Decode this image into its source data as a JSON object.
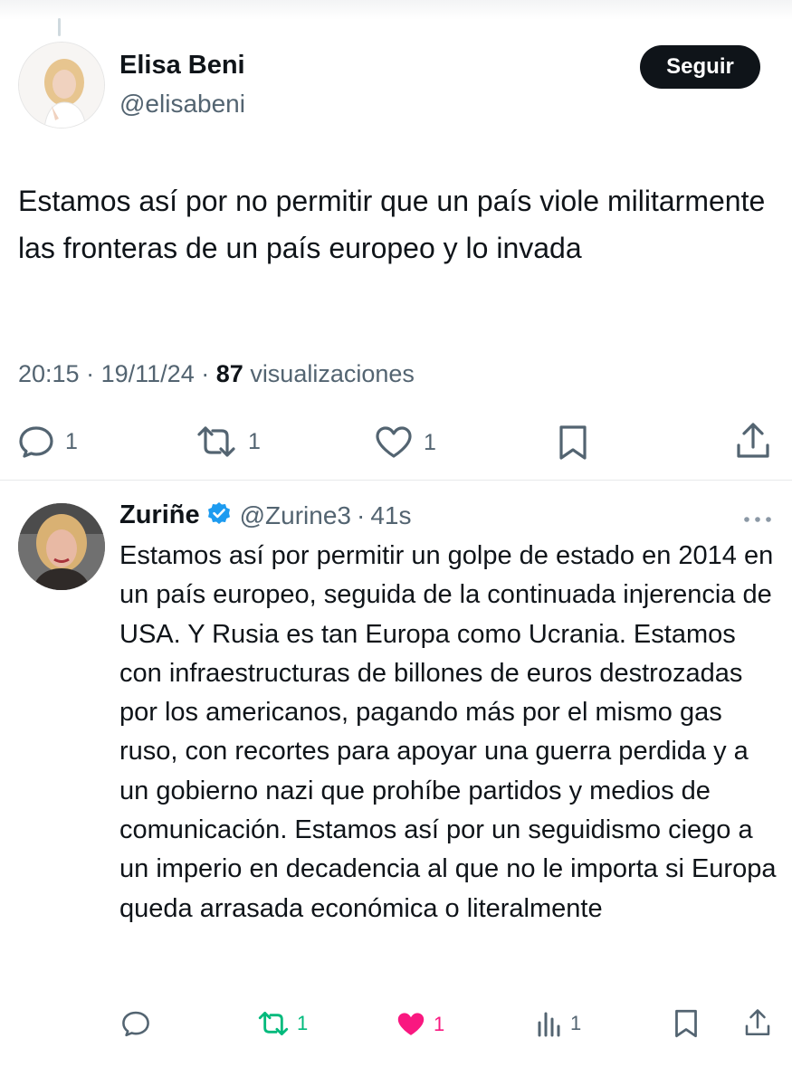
{
  "main_tweet": {
    "author_name": "Elisa Beni",
    "author_handle": "@elisabeni",
    "follow_label": "Seguir",
    "text": "Estamos así por no permitir que un país viole militarmente las fronteras de un país europeo y lo invada",
    "time": "20:15",
    "date": "19/11/24",
    "separator": "·",
    "views_count": "87",
    "views_label": "visualizaciones",
    "actions": {
      "replies": "1",
      "retweets": "1",
      "likes": "1"
    }
  },
  "reply_tweet": {
    "author_name": "Zuriñe",
    "author_handle": "@Zurine3",
    "separator": "·",
    "time_ago": "41s",
    "text": "Estamos así por permitir un golpe de estado en 2014 en un país europeo, seguida de la continuada injerencia de USA. Y Rusia es tan Europa como Ucrania. Estamos con infraestructuras de billones de euros destrozadas por los americanos, pagando más por el mismo gas ruso, con recortes para apoyar una guerra perdida y a un gobierno nazi que prohíbe partidos y medios de comunicación. Estamos así por un seguidismo ciego a un imperio en decadencia al que no le importa si Europa queda arrasada económica o literalmente",
    "actions": {
      "retweets": "1",
      "likes": "1",
      "views": "1"
    }
  },
  "colors": {
    "text_primary": "#0f1419",
    "text_secondary": "#536471",
    "retweet_active": "#00ba7c",
    "like_active": "#f91880",
    "verified_blue": "#1d9bf0"
  },
  "icons": [
    "reply-icon",
    "retweet-icon",
    "like-icon",
    "bookmark-icon",
    "share-icon",
    "views-icon",
    "more-icon",
    "verified-icon"
  ]
}
